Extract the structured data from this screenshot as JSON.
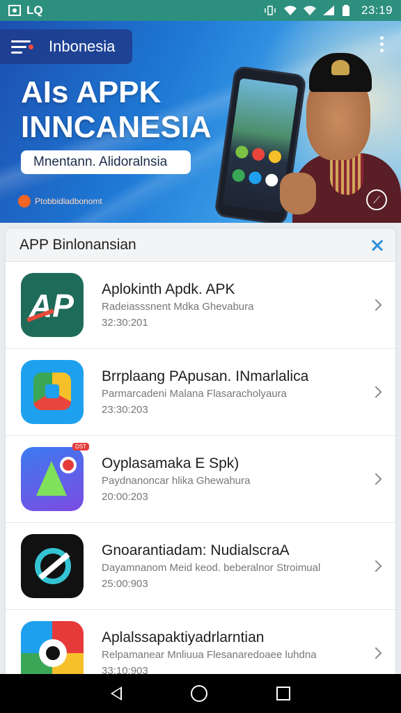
{
  "status_bar": {
    "left_text": "LQ",
    "time": "23:19"
  },
  "header": {
    "title": "Inbonesia"
  },
  "banner": {
    "title_line1": "AIs APPK",
    "title_line2": "INNCANESIA",
    "subtitle": "Mnentann. Alidoralnsia",
    "brand": "Ptobbidladbonomt"
  },
  "panel": {
    "title": "APP Binlonansian"
  },
  "apps": [
    {
      "name": "Aplokinth Apdk. APK",
      "desc": "Radeiasssnent Mdka Ghevabura",
      "date": "32:30:201",
      "icon": "ap-logo-icon"
    },
    {
      "name": "Brrplaang PApusan. INmarlalica",
      "desc": "Parmarcadeni Malana Flasaracholyaura",
      "date": "23:30:203",
      "icon": "drive-logo-icon"
    },
    {
      "name": "Oyplasamaka E Spk)",
      "desc": "Paydnanoncar hlika Ghewahura",
      "date": "20:00:203",
      "icon": "play-logo-icon",
      "badge": "DST"
    },
    {
      "name": "Gnoarantiadam: NudialscraA",
      "desc": "Dayamnanom Meid keod. beberalnor Stroimual",
      "date": "25:00:903",
      "icon": "compass-logo-icon"
    },
    {
      "name": "Aplalssapaktiyadrlarntian",
      "desc": "Relpamanear Mnliuua Flesanaredoaee luhdna",
      "date": "33:10:903",
      "icon": "camera-logo-icon"
    }
  ]
}
